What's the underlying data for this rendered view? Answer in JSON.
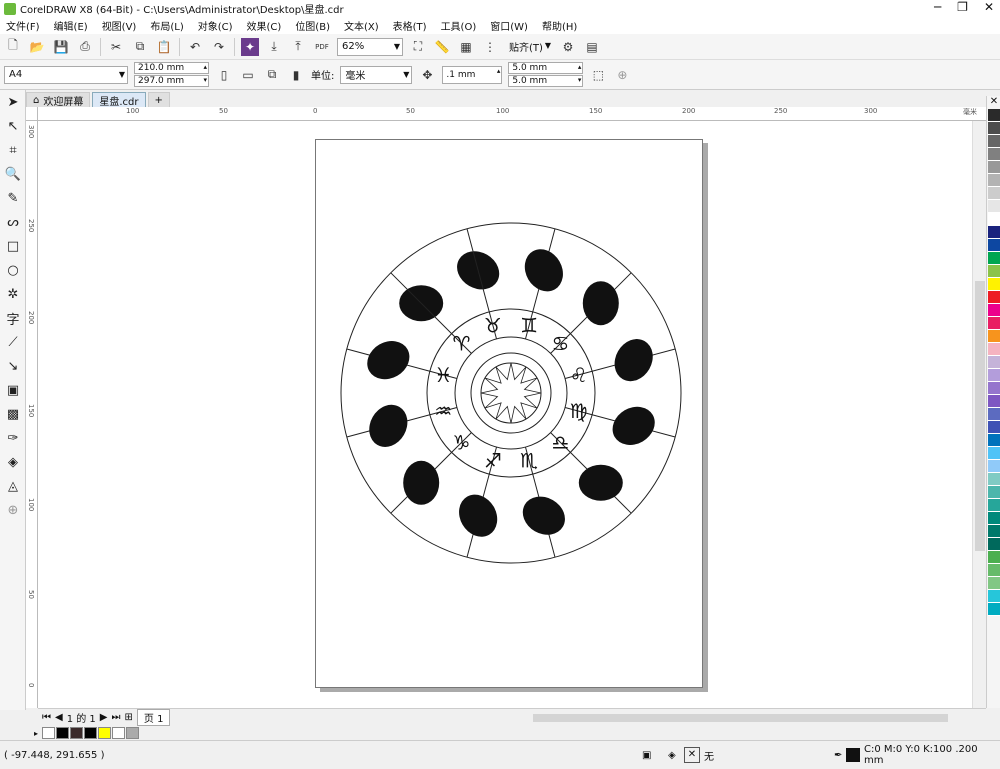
{
  "title": "CorelDRAW X8 (64-Bit) - C:\\Users\\Administrator\\Desktop\\星盘.cdr",
  "menu": [
    "文件(F)",
    "编辑(E)",
    "视图(V)",
    "布局(L)",
    "对象(C)",
    "效果(C)",
    "位图(B)",
    "文本(X)",
    "表格(T)",
    "工具(O)",
    "窗口(W)",
    "帮助(H)"
  ],
  "toolbar": {
    "zoom": "62%",
    "snap": "贴齐(T)",
    "pdf": "PDF"
  },
  "props": {
    "page_size": "A4",
    "width": "210.0 mm",
    "height": "297.0 mm",
    "unit_label": "单位:",
    "unit": "毫米",
    "nudge": ".1 mm",
    "dup_x": "5.0 mm",
    "dup_y": "5.0 mm"
  },
  "tabs": [
    "欢迎屏幕",
    "星盘.cdr"
  ],
  "ruler_h": [
    "100",
    "50",
    "0",
    "50",
    "100",
    "150",
    "200",
    "250",
    "300",
    "毫米"
  ],
  "ruler_v": [
    "300",
    "250",
    "200",
    "150",
    "100",
    "50",
    "0"
  ],
  "page_nav": {
    "counter": "1 的 1",
    "page_tab": "页 1"
  },
  "status": {
    "coords": "( -97.448, 291.655 )",
    "fill": "无",
    "color_info": "C:0 M:0 Y:0 K:100 .200 mm"
  },
  "palette_colors": [
    "#2a2a2a",
    "#4d4d4d",
    "#666",
    "#808080",
    "#999",
    "#b3b3b3",
    "#ccc",
    "#e6e6e6",
    "#fff",
    "#1a237e",
    "#0d47a1",
    "#00a651",
    "#8bc34a",
    "#fff200",
    "#ed1c24",
    "#ec008c",
    "#e91e63",
    "#f7941d",
    "#f5b3c0",
    "#c5b3d9",
    "#b39ddb",
    "#9575cd",
    "#7e57c2",
    "#5c6bc0",
    "#3f51b5",
    "#0072bc",
    "#4fc3f7",
    "#90caf9",
    "#80cbc4",
    "#4db6ac",
    "#26a69a",
    "#00897b",
    "#00796b",
    "#00695c",
    "#4caf50",
    "#66bb6a",
    "#81c784",
    "#26c6da",
    "#00acc1"
  ],
  "doc_palette": [
    "#fff",
    "#000",
    "#3a2a2a",
    "#000",
    "#ffff00",
    "#fff",
    "#aaa"
  ],
  "zodiac_glyphs": [
    "♈",
    "♉",
    "♊",
    "♋",
    "♌",
    "♍",
    "♎",
    "♏",
    "♐",
    "♑",
    "♒",
    "♓"
  ]
}
